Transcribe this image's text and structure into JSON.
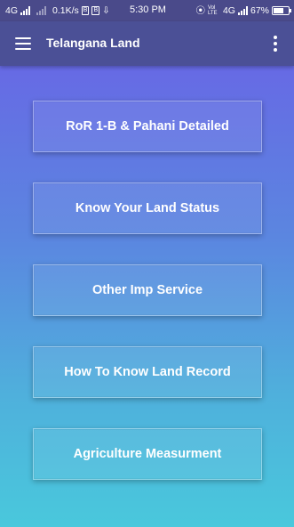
{
  "status_bar": {
    "network": "4G",
    "speed": "0.1K/s",
    "time": "5:30 PM",
    "volte": "Vol LTE",
    "network2": "4G",
    "battery": "67%",
    "battery_level": 0.67
  },
  "app_bar": {
    "title": "Telangana Land",
    "menu_icon": "hamburger-menu-icon",
    "overflow_icon": "more-vertical-icon"
  },
  "menu": {
    "items": [
      {
        "label": "RoR 1-B & Pahani Detailed"
      },
      {
        "label": "Know Your Land Status"
      },
      {
        "label": "Other Imp Service"
      },
      {
        "label": "How To Know Land Record"
      },
      {
        "label": "Agriculture Measurment"
      }
    ]
  }
}
